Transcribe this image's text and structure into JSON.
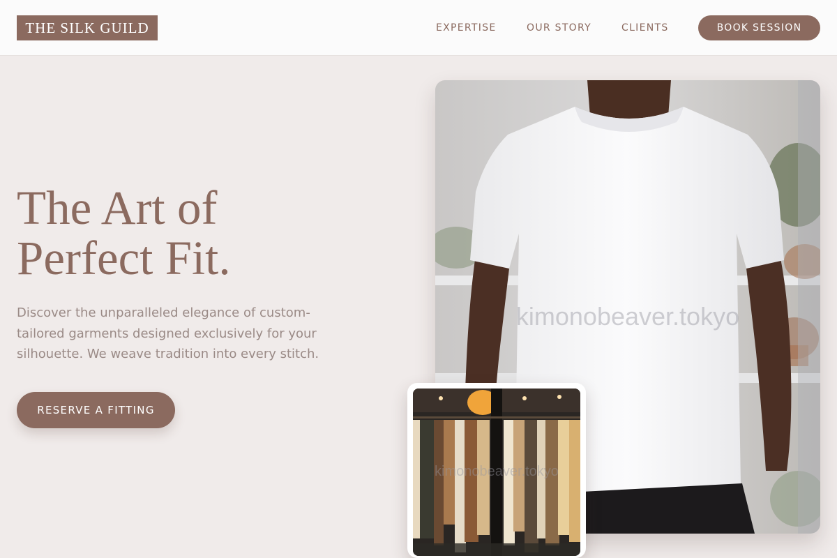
{
  "nav": {
    "logo": "THE SILK GUILD",
    "links": [
      "EXPERTISE",
      "OUR STORY",
      "CLIENTS"
    ],
    "book_label": "BOOK SESSION"
  },
  "hero": {
    "headline_line1": "The Art of",
    "headline_line2": "Perfect Fit.",
    "subtext": "Discover the unparalleled elegance of custom-tailored garments designed exclusively for your silhouette. We weave tradition into every stitch.",
    "cta_label": "RESERVE A FITTING",
    "main_image": "white-tshirt-model-photo",
    "secondary_image": "clothing-rack-photo",
    "watermark": "kimonobeaver.tokyo"
  },
  "colors": {
    "brand": "#8b6a5f",
    "background": "#f0ebea",
    "nav_background": "#fbfbfb",
    "body_text": "#9a8a86"
  }
}
